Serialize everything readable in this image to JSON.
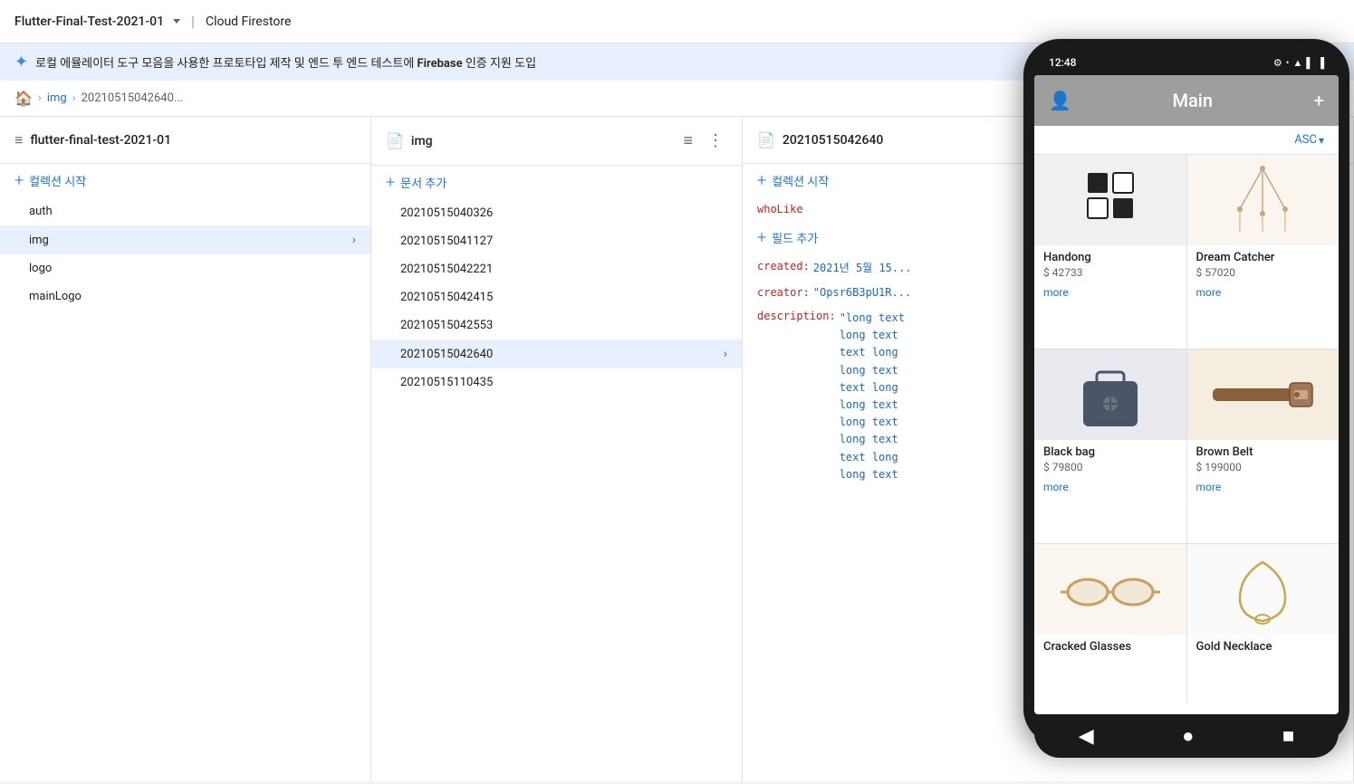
{
  "topbar": {
    "project": "Flutter-Final-Test-2021-01",
    "product": "Cloud Firestore"
  },
  "banner": {
    "text": "로컬 에뮬레이터 도구 모음을 사용한 프로토타입 제작 및 엔드 투 엔드 테스트에",
    "highlight": "Firebase",
    "text2": "인증 지원 도입"
  },
  "breadcrumb": {
    "home": "🏠",
    "items": [
      "img",
      "20210515042640..."
    ]
  },
  "panel1": {
    "title": "flutter-final-test-2021-01",
    "add_label": "컬렉션 시작",
    "items": [
      "auth",
      "img",
      "logo",
      "mainLogo"
    ]
  },
  "panel2": {
    "title": "img",
    "add_label": "문서 추가",
    "items": [
      "20210515040326",
      "20210515041127",
      "20210515042221",
      "20210515042415",
      "20210515042553",
      "20210515042640",
      "20210515110435"
    ],
    "active": "20210515042640"
  },
  "panel3": {
    "title": "20210515042640",
    "add_collection_label": "컬렉션 시작",
    "add_field_label": "필드 추가",
    "fields": [
      {
        "key": "whoLike",
        "value": ""
      },
      {
        "key": "created:",
        "value": "2021년 5월 15..."
      },
      {
        "key": "creator:",
        "value": "\"Opsr6B3pU1R..."
      },
      {
        "key": "description:",
        "value": "\"long text long text long text long text long text long text long text long text long text long text\""
      }
    ]
  },
  "phone": {
    "time": "12:48",
    "title": "Main",
    "sort_label": "ASC",
    "products": [
      {
        "name": "Handong",
        "price": "$ 42733",
        "more": "more",
        "img_type": "handong"
      },
      {
        "name": "Dream Catcher",
        "price": "$ 57020",
        "more": "more",
        "img_type": "dreamcatcher"
      },
      {
        "name": "Black bag",
        "price": "$ 79800",
        "more": "more",
        "img_type": "blackbag"
      },
      {
        "name": "Brown Belt",
        "price": "$ 199000",
        "more": "more",
        "img_type": "brownbelt"
      },
      {
        "name": "Cracked Glasses",
        "price": "",
        "more": "",
        "img_type": "crackedglasses"
      },
      {
        "name": "Gold Necklace",
        "price": "",
        "more": "",
        "img_type": "goldnecklace"
      }
    ]
  }
}
